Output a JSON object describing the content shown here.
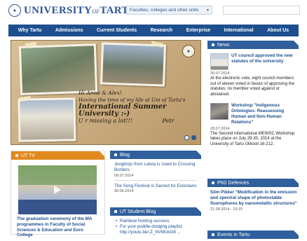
{
  "header": {
    "logo_text_main": "UNIVERSITY",
    "logo_text_of": "OF",
    "logo_text_city": "TARTU",
    "faculties_label": "Faculties, colleges and other units",
    "search": {
      "placeholder": "",
      "value": ""
    }
  },
  "nav": {
    "items": [
      "Why Tartu",
      "Admissions",
      "Current Students",
      "Research",
      "Enterprise",
      "International",
      "About Us"
    ]
  },
  "hero": {
    "handwriting": [
      "Hi Anna & Alex!",
      "Having the time of my life at Uni of Tartu's",
      "International Summer University :-)",
      "U r missing a lot!!!"
    ],
    "signature": "Petr"
  },
  "news": {
    "heading": "News",
    "items": [
      {
        "title": "UT council approved the new statutes of the university",
        "date": "30.07.2014",
        "description": "At the electronic vote, eight council members out of eleven voted in favour of approving the statutes; no member voted against or abstained."
      },
      {
        "title": "Workshop \"Indigenous Ontologies: Reassessing Human and Non-Human Relations\"",
        "date": "28.07.2014",
        "description": "The Second International MEWSC Workshop takes place on July 29-30, 2014 at the University of Tartu Ülikooli 16-212."
      }
    ]
  },
  "phd": {
    "heading": "PhD Defences",
    "item": {
      "title": "Siim Pikker \"Modification in the emission and spectral shape of photostable fluorophores by nanometallic structures\"",
      "date": "21.08.2014 - 15:15"
    }
  },
  "events": {
    "heading": "Events in Tartu"
  },
  "ut_tv": {
    "heading": "UT TV",
    "caption": "The graduation ceremony of the MA programmes in Faculty of Social Sciences & Education and Euro College"
  },
  "blog": {
    "heading": "Blog",
    "items": [
      {
        "title": "Jevgēnijs from Latvia is Used to Crossing Borders",
        "date": "09.07.2014"
      },
      {
        "title": "The Song Festival is Sacred for Estonians",
        "date": "30.06.2014"
      }
    ]
  },
  "student_blog": {
    "heading": "UT Student Blog",
    "items": [
      "Rainbow hunting success.",
      "For your puddle-dodging playlist: http://youtu.be/-Z_NVMUkG8 ..."
    ]
  },
  "colors": {
    "brand_blue": "#1d4f8f",
    "section_blue": "#2f5f9c",
    "section_orange": "#e08a1e"
  }
}
